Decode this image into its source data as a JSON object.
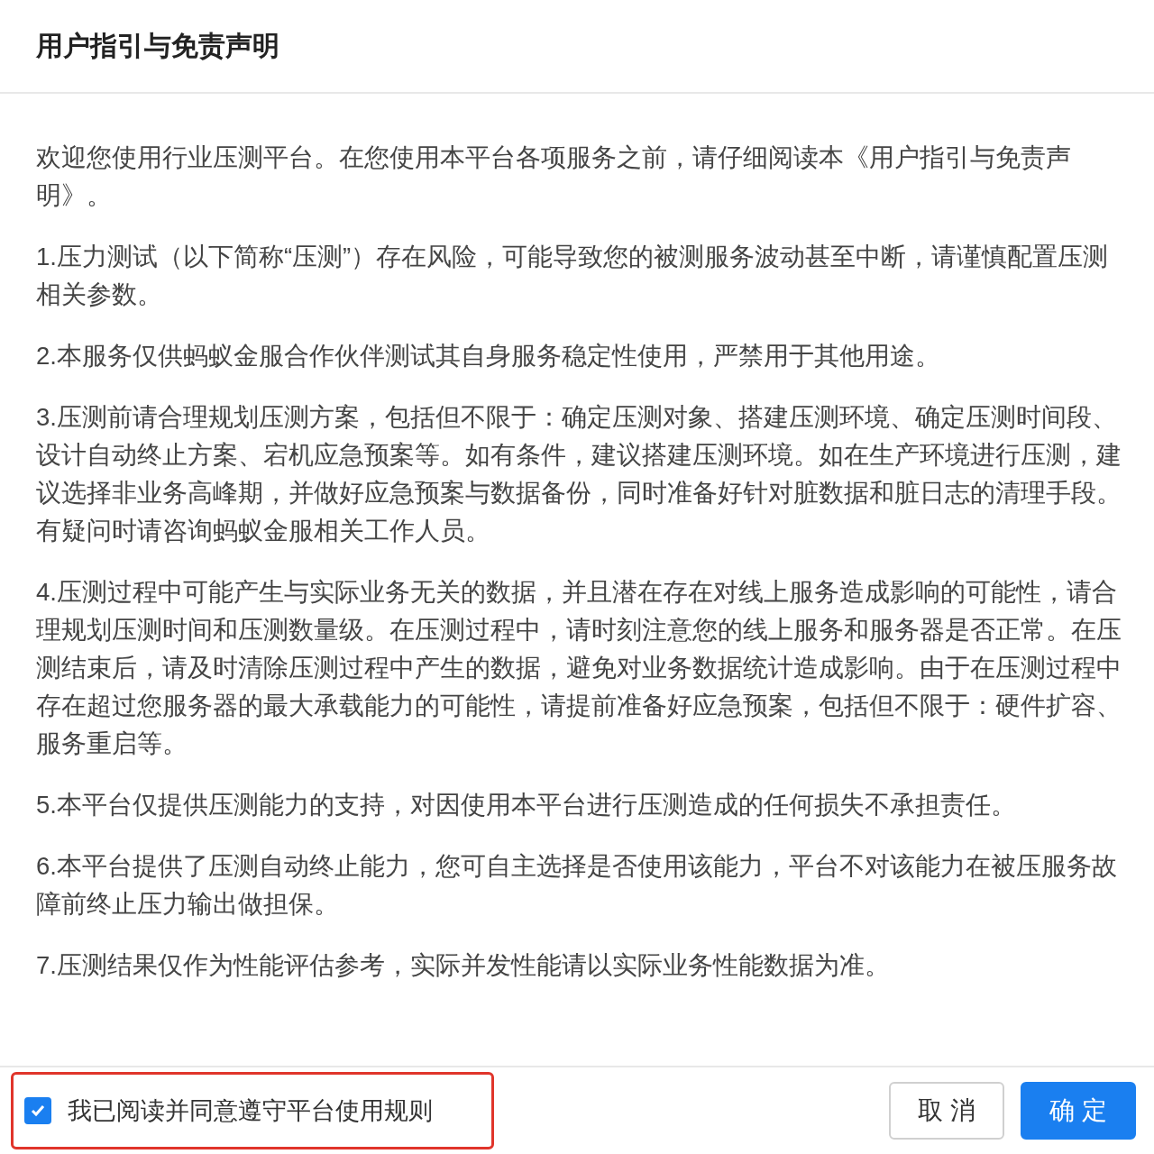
{
  "dialog": {
    "title": "用户指引与免责声明",
    "paragraphs": [
      "欢迎您使用行业压测平台。在您使用本平台各项服务之前，请仔细阅读本《用户指引与免责声明》。",
      "1.压力测试（以下简称“压测”）存在风险，可能导致您的被测服务波动甚至中断，请谨慎配置压测相关参数。",
      "2.本服务仅供蚂蚁金服合作伙伴测试其自身服务稳定性使用，严禁用于其他用途。",
      "3.压测前请合理规划压测方案，包括但不限于：确定压测对象、搭建压测环境、确定压测时间段、设计自动终止方案、宕机应急预案等。如有条件，建议搭建压测环境。如在生产环境进行压测，建议选择非业务高峰期，并做好应急预案与数据备份，同时准备好针对脏数据和脏日志的清理手段。有疑问时请咨询蚂蚁金服相关工作人员。",
      "4.压测过程中可能产生与实际业务无关的数据，并且潜在存在对线上服务造成影响的可能性，请合理规划压测时间和压测数量级。在压测过程中，请时刻注意您的线上服务和服务器是否正常。在压测结束后，请及时清除压测过程中产生的数据，避免对业务数据统计造成影响。由于在压测过程中存在超过您服务器的最大承载能力的可能性，请提前准备好应急预案，包括但不限于：硬件扩容、服务重启等。",
      "5.本平台仅提供压测能力的支持，对因使用本平台进行压测造成的任何损失不承担责任。",
      "6.本平台提供了压测自动终止能力，您可自主选择是否使用该能力，平台不对该能力在被压服务故障前终止压力输出做担保。",
      "7.压测结果仅作为性能评估参考，实际并发性能请以实际业务性能数据为准。"
    ],
    "agreement": {
      "label": "我已阅读并同意遵守平台使用规则",
      "checked": true,
      "highlighted": true
    },
    "buttons": [
      {
        "label": "取 消",
        "kind": "secondary"
      },
      {
        "label": "确 定",
        "kind": "primary"
      }
    ]
  }
}
